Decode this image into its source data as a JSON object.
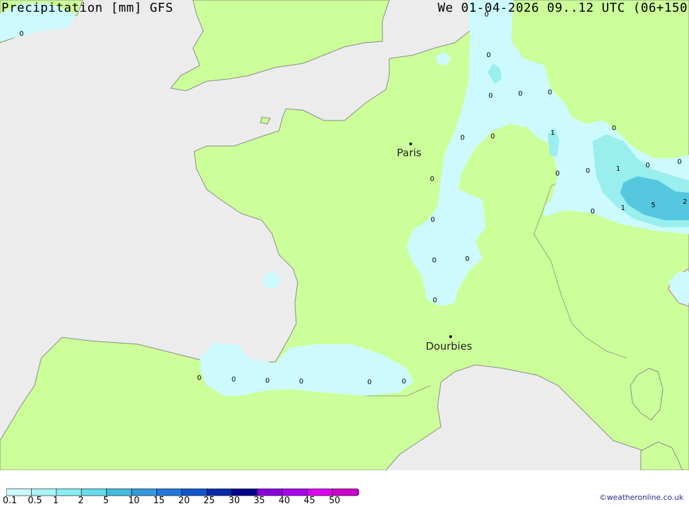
{
  "header": {
    "title": "Precipitation [mm] GFS",
    "run_info": "We 01-04-2026 09..12 UTC (06+150"
  },
  "credit": "©weatheronline.co.uk",
  "colors": {
    "sea": "#ececec",
    "land": "#ccff99",
    "coast": "#8a8a8a",
    "precip_light": "#ccfaff",
    "precip_mid": "#99eeee",
    "precip_dark": "#55c8e0"
  },
  "cities": [
    {
      "name": "Paris"
    },
    {
      "name": "Dourbies"
    }
  ],
  "values": [
    "0",
    "0",
    "0",
    "0",
    "0",
    "0",
    "1",
    "0",
    "0",
    "0",
    "0",
    "0",
    "1",
    "0",
    "0",
    "0",
    "5",
    "2",
    "1",
    "0",
    "0",
    "0",
    "0",
    "0",
    "0",
    "0",
    "0",
    "0",
    "0",
    "0",
    "0",
    "0",
    "0",
    "0"
  ],
  "legend": {
    "items": [
      {
        "label": "0.1",
        "color": "#ccfaff"
      },
      {
        "label": "0.5",
        "color": "#aaf4f8"
      },
      {
        "label": "1",
        "color": "#88eef0"
      },
      {
        "label": "2",
        "color": "#66dde8"
      },
      {
        "label": "5",
        "color": "#44bbdd"
      },
      {
        "label": "10",
        "color": "#3399dd"
      },
      {
        "label": "15",
        "color": "#2277dd"
      },
      {
        "label": "20",
        "color": "#1155cc"
      },
      {
        "label": "25",
        "color": "#0a2aaa"
      },
      {
        "label": "30",
        "color": "#000088"
      },
      {
        "label": "35",
        "color": "#8800dd"
      },
      {
        "label": "40",
        "color": "#aa00ee"
      },
      {
        "label": "45",
        "color": "#dd00ee"
      },
      {
        "label": "50",
        "color": "#cc00cc"
      }
    ],
    "overflow_color": "#aa00aa"
  }
}
